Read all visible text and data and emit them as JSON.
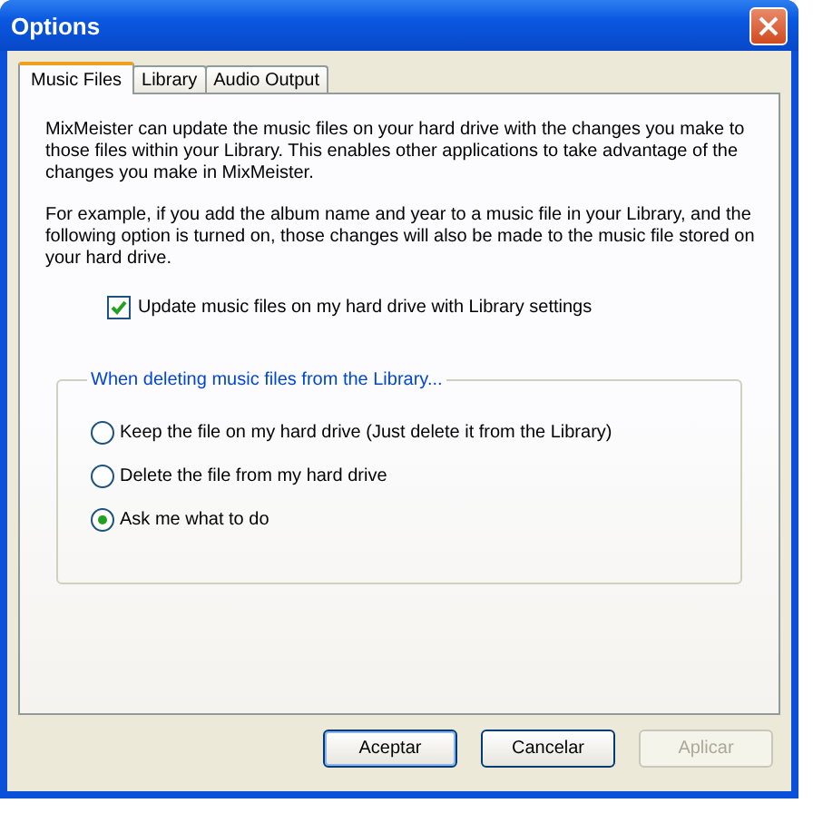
{
  "window": {
    "title": "Options"
  },
  "tabs": [
    {
      "label": "Music Files",
      "selected": true
    },
    {
      "label": "Library",
      "selected": false
    },
    {
      "label": "Audio Output",
      "selected": false
    }
  ],
  "paragraphs": [
    "MixMeister can update the music files on your hard drive with the changes you make to those files within your Library. This enables other applications to take advantage of the changes you make in MixMeister.",
    "For example, if you add the album name and year to a music file in your Library, and the following option is turned on, those changes will also be made to the music file stored on your hard drive."
  ],
  "update_option": {
    "label": "Update music files on my hard drive with Library settings",
    "checked": true
  },
  "delete_group": {
    "title": "When deleting music files from the Library...",
    "options": [
      {
        "label": "Keep the file on my hard drive (Just delete it from the Library)",
        "selected": false
      },
      {
        "label": "Delete the file from my hard drive",
        "selected": false
      },
      {
        "label": "Ask me what to do",
        "selected": true
      }
    ]
  },
  "buttons": [
    {
      "label": "Aceptar",
      "disabled": false,
      "default": true
    },
    {
      "label": "Cancelar",
      "disabled": false,
      "default": false
    },
    {
      "label": "Aplicar",
      "disabled": true,
      "default": false
    }
  ]
}
